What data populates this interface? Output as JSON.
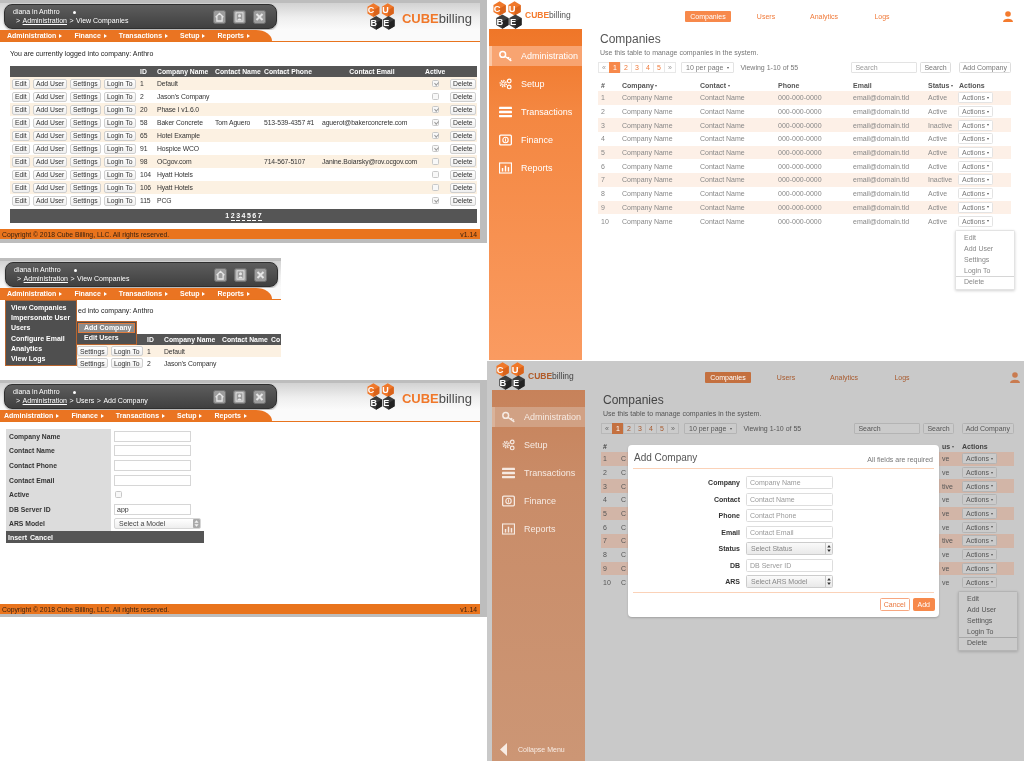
{
  "legacy_companies": {
    "header": {
      "user": "diana in Anthro",
      "breadcrumb": [
        {
          "text": ">",
          "kind": "separator"
        },
        {
          "text": "Administration",
          "kind": "link"
        },
        {
          "text": ">",
          "kind": "separator"
        },
        {
          "text": "View Companies",
          "kind": "current"
        }
      ],
      "logo": {
        "letters": [
          "C",
          "U",
          "B",
          "E"
        ],
        "wordmark": "**CUBE**billing"
      }
    },
    "nav": [
      {
        "label": "Administration"
      },
      {
        "label": "Finance"
      },
      {
        "label": "Transactions"
      },
      {
        "label": "Setup"
      },
      {
        "label": "Reports"
      }
    ],
    "notice": "You are currently logged into company: Anthro",
    "table": {
      "columns": [
        "ID",
        "Company Name",
        "Contact Name",
        "Contact Phone",
        "Contact Email",
        "Active"
      ],
      "rows": [
        {
          "buttons": [
            "Edit",
            "Add User",
            "Settings",
            "Login To"
          ],
          "id": "1",
          "company": "Default",
          "active": true,
          "delete": "Delete"
        },
        {
          "buttons": [
            "Edit",
            "Add User",
            "Settings",
            "Login To"
          ],
          "id": "2",
          "company": "Jason's Company",
          "active": false,
          "delete": "Delete"
        },
        {
          "buttons": [
            "Edit",
            "Add User",
            "Settings",
            "Login To"
          ],
          "id": "20",
          "company": "Phase I v1.6.0",
          "active": true,
          "delete": "Delete"
        },
        {
          "buttons": [
            "Edit",
            "Add User",
            "Settings",
            "Login To"
          ],
          "id": "58",
          "company": "Baker Concrete",
          "contact": "Tom Aguero",
          "phone": "513-539-4357 #1",
          "email": "aguerot@bakerconcrete.com",
          "active": true,
          "delete": "Delete"
        },
        {
          "buttons": [
            "Edit",
            "Add User",
            "Settings",
            "Login To"
          ],
          "id": "65",
          "company": "Hotel Example",
          "active": true,
          "delete": "Delete"
        },
        {
          "buttons": [
            "Edit",
            "Add User",
            "Settings",
            "Login To"
          ],
          "id": "91",
          "company": "Hospice WCO",
          "active": true,
          "delete": "Delete"
        },
        {
          "buttons": [
            "Edit",
            "Add User",
            "Settings",
            "Login To"
          ],
          "id": "98",
          "company": "OCgov.com",
          "phone": "714-567-5107",
          "email": "Janine.Boiarsky@rov.ocgov.com",
          "active": false,
          "delete": "Delete"
        },
        {
          "buttons": [
            "Edit",
            "Add User",
            "Settings",
            "Login To"
          ],
          "id": "104",
          "company": "Hyatt Hotels",
          "active": false,
          "delete": "Delete"
        },
        {
          "buttons": [
            "Edit",
            "Add User",
            "Settings",
            "Login To"
          ],
          "id": "106",
          "company": "Hyatt Hotels",
          "active": false,
          "delete": "Delete"
        },
        {
          "buttons": [
            "Edit",
            "Add User",
            "Settings",
            "Login To"
          ],
          "id": "115",
          "company": "PCG",
          "active": true,
          "delete": "Delete"
        }
      ]
    },
    "pages": [
      {
        "label": "1",
        "selected": true
      },
      {
        "label": "2",
        "selected": false
      },
      {
        "label": "3",
        "selected": false
      },
      {
        "label": "4",
        "selected": false
      },
      {
        "label": "5",
        "selected": false
      },
      {
        "label": "6",
        "selected": false
      },
      {
        "label": "7",
        "selected": false
      }
    ],
    "footer": {
      "copyright": "Copyright © 2018 Cube Billing, LLC. All rights reserved.",
      "version": "v1.14"
    }
  },
  "legacy_company_menu": {
    "header": {
      "user": "diana in Anthro",
      "breadcrumb": [
        {
          "text": ">",
          "kind": "separator"
        },
        {
          "text": "Administration",
          "kind": "link"
        },
        {
          "text": ">",
          "kind": "separator"
        },
        {
          "text": "View Companies",
          "kind": "current"
        }
      ]
    },
    "nav": [
      {
        "label": "Administration"
      },
      {
        "label": "Finance"
      },
      {
        "label": "Transactions"
      },
      {
        "label": "Setup"
      },
      {
        "label": "Reports"
      }
    ],
    "notice": "ed into company: Anthro",
    "table": {
      "columns": [
        "ID",
        "Company Name",
        "Contact Name",
        "Co"
      ],
      "rows": [
        {
          "buttons": [
            "Settings",
            "Login To"
          ],
          "id": "1",
          "company": "Default"
        },
        {
          "buttons": [
            "Settings",
            "Login To"
          ],
          "id": "2",
          "company": "Jason's Company"
        }
      ]
    },
    "menu": [
      {
        "label": "View Companies"
      },
      {
        "label": "Impersonate User"
      },
      {
        "label": "Users",
        "submenu": [
          {
            "label": "Add Company",
            "selected": true
          },
          {
            "label": "Edit Users",
            "selected": false
          }
        ]
      },
      {
        "label": "Configure Email"
      },
      {
        "label": "Analytics"
      },
      {
        "label": "View Logs"
      }
    ]
  },
  "legacy_add_company": {
    "header": {
      "user": "diana in Anthro",
      "breadcrumb": [
        {
          "text": ">",
          "kind": "separator"
        },
        {
          "text": "Administration",
          "kind": "link"
        },
        {
          "text": ">",
          "kind": "separator"
        },
        {
          "text": "Users",
          "kind": "text"
        },
        {
          "text": ">",
          "kind": "separator"
        },
        {
          "text": "Add Company",
          "kind": "current"
        }
      ],
      "logo": {
        "letters": [
          "C",
          "U",
          "B",
          "E"
        ],
        "wordmark": "**CUBE**billing"
      }
    },
    "nav": [
      {
        "label": "Administration"
      },
      {
        "label": "Finance"
      },
      {
        "label": "Transactions"
      },
      {
        "label": "Setup"
      },
      {
        "label": "Reports"
      }
    ],
    "form": {
      "fields": [
        {
          "label": "Company Name",
          "kind": "text"
        },
        {
          "label": "Contact Name",
          "kind": "text"
        },
        {
          "label": "Contact Phone",
          "kind": "text"
        },
        {
          "label": "Contact Email",
          "kind": "text"
        },
        {
          "label": "Active",
          "kind": "checkbox",
          "checked": false
        },
        {
          "label": "DB Server ID",
          "kind": "text",
          "value": "app"
        },
        {
          "label": "ARS Model",
          "kind": "select",
          "value": "Select a Model"
        }
      ],
      "actions": [
        "Insert",
        "Cancel"
      ]
    },
    "footer": {
      "copyright": "Copyright © 2018 Cube Billing, LLC. All rights reserved.",
      "version": "v1.14"
    }
  },
  "companies": {
    "logo": {
      "letters": [
        "C",
        "U",
        "B",
        "E"
      ],
      "wordmark": "**CUBE**billing"
    },
    "sidebar": [
      {
        "label": "Administration",
        "selected": true
      },
      {
        "label": "Setup",
        "selected": false
      },
      {
        "label": "Transactions",
        "selected": false
      },
      {
        "label": "Finance",
        "selected": false
      },
      {
        "label": "Reports",
        "selected": false
      }
    ],
    "tabs": [
      {
        "label": "Companies",
        "selected": true
      },
      {
        "label": "Users",
        "selected": false
      },
      {
        "label": "Analytics",
        "selected": false
      },
      {
        "label": "Logs",
        "selected": false
      }
    ],
    "title": "Companies",
    "subtitle": "Use this table to manage companies in the system.",
    "pagination": [
      {
        "label": "«",
        "kind": "prev",
        "selected": false
      },
      {
        "label": "1",
        "kind": "page",
        "selected": true
      },
      {
        "label": "2",
        "kind": "page",
        "selected": false
      },
      {
        "label": "3",
        "kind": "page",
        "selected": false
      },
      {
        "label": "4",
        "kind": "page",
        "selected": false
      },
      {
        "label": "5",
        "kind": "page",
        "selected": false
      },
      {
        "label": "»",
        "kind": "next",
        "selected": false
      }
    ],
    "per_page": "10 per page",
    "viewing": "Viewing 1-10 of 55",
    "search": {
      "placeholder": "Search",
      "button": "Search"
    },
    "add_button": "Add Company",
    "table": {
      "header": {
        "number": {
          "label": "#",
          "sortable": false
        },
        "company": {
          "label": "Company",
          "sortable": true
        },
        "contact": {
          "label": "Contact",
          "sortable": true
        },
        "phone": {
          "label": "Phone",
          "sortable": false
        },
        "email": {
          "label": "Email",
          "sortable": false
        },
        "status": {
          "label": "Status",
          "sortable": true
        },
        "action": {
          "label": "Actions",
          "sortable": false
        }
      },
      "rows": [
        {
          "number": "1",
          "company": "Company Name",
          "contact": "Contact Name",
          "phone": "000-000-0000",
          "email": "email@domain.tld",
          "status": "Active",
          "action": "Actions"
        },
        {
          "number": "2",
          "company": "Company Name",
          "contact": "Contact Name",
          "phone": "000-000-0000",
          "email": "email@domain.tld",
          "status": "Active",
          "action": "Actions"
        },
        {
          "number": "3",
          "company": "Company Name",
          "contact": "Contact Name",
          "phone": "000-000-0000",
          "email": "email@domain.tld",
          "status": "Inactive",
          "action": "Actions"
        },
        {
          "number": "4",
          "company": "Company Name",
          "contact": "Contact Name",
          "phone": "000-000-0000",
          "email": "email@domain.tld",
          "status": "Active",
          "action": "Actions"
        },
        {
          "number": "5",
          "company": "Company Name",
          "contact": "Contact Name",
          "phone": "000-000-0000",
          "email": "email@domain.tld",
          "status": "Active",
          "action": "Actions"
        },
        {
          "number": "6",
          "company": "Company Name",
          "contact": "Contact Name",
          "phone": "000-000-0000",
          "email": "email@domain.tld",
          "status": "Active",
          "action": "Actions"
        },
        {
          "number": "7",
          "company": "Company Name",
          "contact": "Contact Name",
          "phone": "000-000-0000",
          "email": "email@domain.tld",
          "status": "Inactive",
          "action": "Actions"
        },
        {
          "number": "8",
          "company": "Company Name",
          "contact": "Contact Name",
          "phone": "000-000-0000",
          "email": "email@domain.tld",
          "status": "Active",
          "action": "Actions"
        },
        {
          "number": "9",
          "company": "Company Name",
          "contact": "Contact Name",
          "phone": "000-000-0000",
          "email": "email@domain.tld",
          "status": "Active",
          "action": "Actions"
        },
        {
          "number": "10",
          "company": "Company Name",
          "contact": "Contact Name",
          "phone": "000-000-0000",
          "email": "email@domain.tld",
          "status": "Active",
          "action": "Actions"
        }
      ]
    },
    "action_menu": [
      {
        "label": "Edit",
        "separated": false
      },
      {
        "label": "Add User",
        "separated": false
      },
      {
        "label": "Settings",
        "separated": false
      },
      {
        "label": "Login To",
        "separated": false
      },
      {
        "label": "Delete",
        "separated": true
      }
    ]
  },
  "companies_add_company": {
    "logo": {
      "letters": [
        "C",
        "U",
        "B",
        "E"
      ],
      "wordmark": "**CUBE**billing"
    },
    "sidebar": [
      {
        "label": "Administration",
        "selected": true
      },
      {
        "label": "Setup",
        "selected": false
      },
      {
        "label": "Transactions",
        "selected": false
      },
      {
        "label": "Finance",
        "selected": false
      },
      {
        "label": "Reports",
        "selected": false
      }
    ],
    "collapse": "Collapse Menu",
    "tabs": [
      {
        "label": "Companies",
        "selected": true
      },
      {
        "label": "Users",
        "selected": false
      },
      {
        "label": "Analytics",
        "selected": false
      },
      {
        "label": "Logs",
        "selected": false
      }
    ],
    "title": "Companies",
    "subtitle": "Use this table to manage companies in the system.",
    "pagination": [
      {
        "label": "«",
        "kind": "prev",
        "selected": false
      },
      {
        "label": "1",
        "kind": "page",
        "selected": true
      },
      {
        "label": "2",
        "kind": "page",
        "selected": false
      },
      {
        "label": "3",
        "kind": "page",
        "selected": false
      },
      {
        "label": "4",
        "kind": "page",
        "selected": false
      },
      {
        "label": "5",
        "kind": "page",
        "selected": false
      },
      {
        "label": "»",
        "kind": "next",
        "selected": false
      }
    ],
    "per_page": "10 per page",
    "viewing": "Viewing 1-10 of 55",
    "search": {
      "placeholder": "Search",
      "button": "Search"
    },
    "add_button": "Add Company",
    "table": {
      "header": {
        "number": {
          "label": "#",
          "sortable": false
        },
        "status": {
          "label": "us",
          "sortable": true
        },
        "action": {
          "label": "Actions",
          "sortable": false
        }
      },
      "rows": [
        {
          "number": "1",
          "company": "C",
          "status": "ve",
          "action": "Actions"
        },
        {
          "number": "2",
          "company": "C",
          "status": "ve",
          "action": "Actions"
        },
        {
          "number": "3",
          "company": "C",
          "status": "tive",
          "action": "Actions"
        },
        {
          "number": "4",
          "company": "C",
          "status": "ve",
          "action": "Actions"
        },
        {
          "number": "5",
          "company": "C",
          "status": "ve",
          "action": "Actions"
        },
        {
          "number": "6",
          "company": "C",
          "status": "ve",
          "action": "Actions"
        },
        {
          "number": "7",
          "company": "C",
          "status": "tive",
          "action": "Actions"
        },
        {
          "number": "8",
          "company": "C",
          "status": "ve",
          "action": "Actions"
        },
        {
          "number": "9",
          "company": "C",
          "status": "ve",
          "action": "Actions"
        },
        {
          "number": "10",
          "company": "C",
          "status": "ve",
          "action": "Actions"
        }
      ]
    },
    "action_menu": [
      {
        "label": "Edit",
        "separated": false
      },
      {
        "label": "Add User",
        "separated": false
      },
      {
        "label": "Settings",
        "separated": false
      },
      {
        "label": "Login To",
        "separated": false
      },
      {
        "label": "Delete",
        "separated": true
      }
    ],
    "modal": {
      "title": "Add Company",
      "note": "All fields are required",
      "fields": [
        {
          "label": "Company",
          "kind": "text",
          "placeholder": "Company Name"
        },
        {
          "label": "Contact",
          "kind": "text",
          "placeholder": "Contact Name"
        },
        {
          "label": "Phone",
          "kind": "text",
          "placeholder": "Contact Phone"
        },
        {
          "label": "Email",
          "kind": "text",
          "placeholder": "Contact Email"
        },
        {
          "label": "Status",
          "kind": "select",
          "placeholder": "Select Status"
        },
        {
          "label": "DB",
          "kind": "text",
          "placeholder": "DB Server ID"
        },
        {
          "label": "ARS",
          "kind": "select",
          "placeholder": "Select ARS Model"
        }
      ],
      "buttons": [
        {
          "label": "Cancel",
          "kind": "secondary"
        },
        {
          "label": "Add",
          "kind": "primary"
        }
      ]
    }
  }
}
